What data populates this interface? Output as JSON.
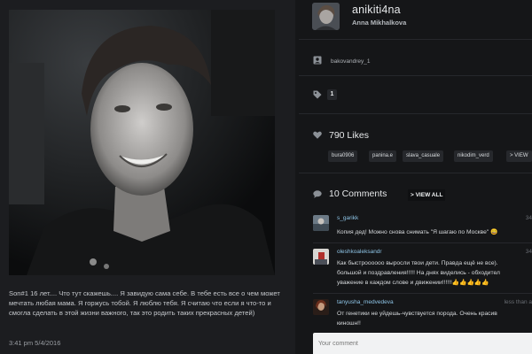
{
  "post": {
    "caption": "Son#1 16 лет.... Что тут скажешь.... Я завидую сама себе. В тебе есть все о чем может мечтать любая мама. Я горжусь тобой. Я люблю тебя. Я считаю что если я что-то и смогла сделать в этой жизни важного, так это родить таких прекрасных детей)",
    "time": "3:41 pm 5/4/2016"
  },
  "profile": {
    "username": "anikiti4na",
    "full_name": "Anna Mikhalkova"
  },
  "tagged": {
    "icon": "user-tag-icon",
    "user": "bakovandrey_1"
  },
  "tags": {
    "icon": "tag-icon",
    "count": "1"
  },
  "likes": {
    "icon": "heart-icon",
    "count_label": "790 Likes",
    "users": [
      "bura0906",
      "panina.e",
      "slava_casuale",
      "nikodim_verd",
      "> VIEW"
    ]
  },
  "comments": {
    "icon": "speech-bubble-icon",
    "count_label": "10 Comments",
    "view_all": "> VIEW ALL",
    "items": [
      {
        "user": "s_garikk",
        "text": "Копия дед! Можно снова снимать \"Я шагаю по Москве\" 😄",
        "time": "34"
      },
      {
        "user": "oleshkoaleksandr",
        "text": "Как быстроооооо выросли твои дети. Правда ещё не все).\nбольшой и поздравления!!!!! На днях виделись - обходител\nуважение в каждом слове и движении!!!!!!👍👍👍👍👍",
        "time": "34"
      },
      {
        "user": "tanyusha_medvedeva",
        "text": "От генетики не уйдешь-чувствуется порода. Очень красив\nкиношн!!",
        "time": "less than a"
      }
    ],
    "input_placeholder": "Your comment"
  },
  "colors": {
    "background": "#151618",
    "panel": "#1c1d20",
    "link": "#8ec4e6",
    "chip": "#26282c"
  }
}
